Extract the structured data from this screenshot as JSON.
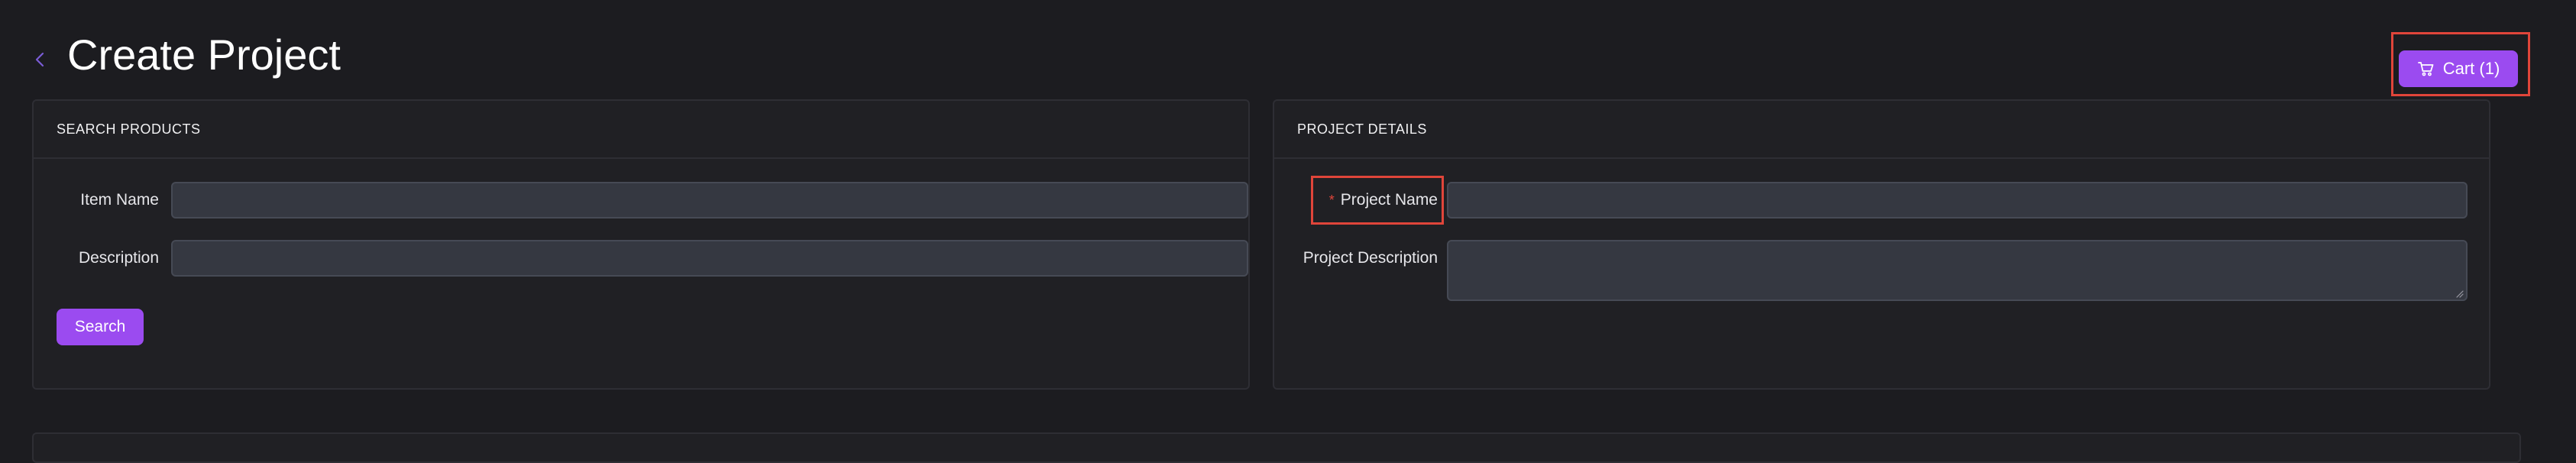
{
  "page": {
    "title": "Create Project"
  },
  "cart": {
    "label": "Cart (1)",
    "icon": "cart-icon"
  },
  "search_products": {
    "header": "SEARCH PRODUCTS",
    "item_name_label": "Item Name",
    "item_name_value": "",
    "description_label": "Description",
    "description_value": "",
    "search_button": "Search"
  },
  "project_details": {
    "header": "PROJECT DETAILS",
    "required_mark": "*",
    "project_name_label": "Project Name",
    "project_name_value": "",
    "project_description_label": "Project Description",
    "project_description_value": ""
  },
  "colors": {
    "accent": "#9b4bf0",
    "background": "#1c1c20",
    "card": "#202024",
    "input": "#353841",
    "highlight": "#e0453a"
  }
}
